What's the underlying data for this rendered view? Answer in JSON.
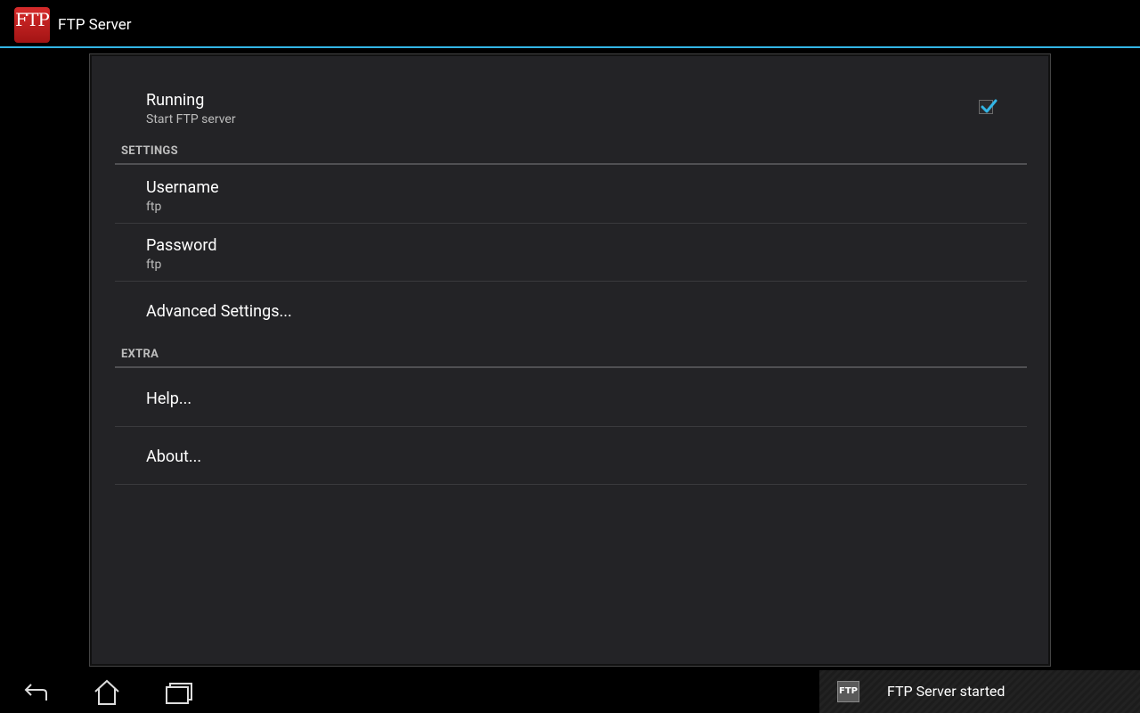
{
  "app": {
    "title": "FTP Server",
    "icon_text": "FTP"
  },
  "prefs": {
    "running": {
      "title": "Running",
      "summary": "Start FTP server",
      "checked": true
    },
    "settings_header": "SETTINGS",
    "username": {
      "title": "Username",
      "summary": "ftp"
    },
    "password": {
      "title": "Password",
      "summary": "ftp"
    },
    "advanced": {
      "title": "Advanced Settings..."
    },
    "extra_header": "EXTRA",
    "help": {
      "title": "Help..."
    },
    "about": {
      "title": "About..."
    }
  },
  "navbar": {
    "buttons": [
      "back-icon",
      "home-icon",
      "recents-icon"
    ]
  },
  "notification": {
    "icon_text": "FTP",
    "text": "FTP Server started"
  },
  "colors": {
    "accent": "#33b5e5",
    "app_icon": "#c62020",
    "panel": "#232326"
  }
}
